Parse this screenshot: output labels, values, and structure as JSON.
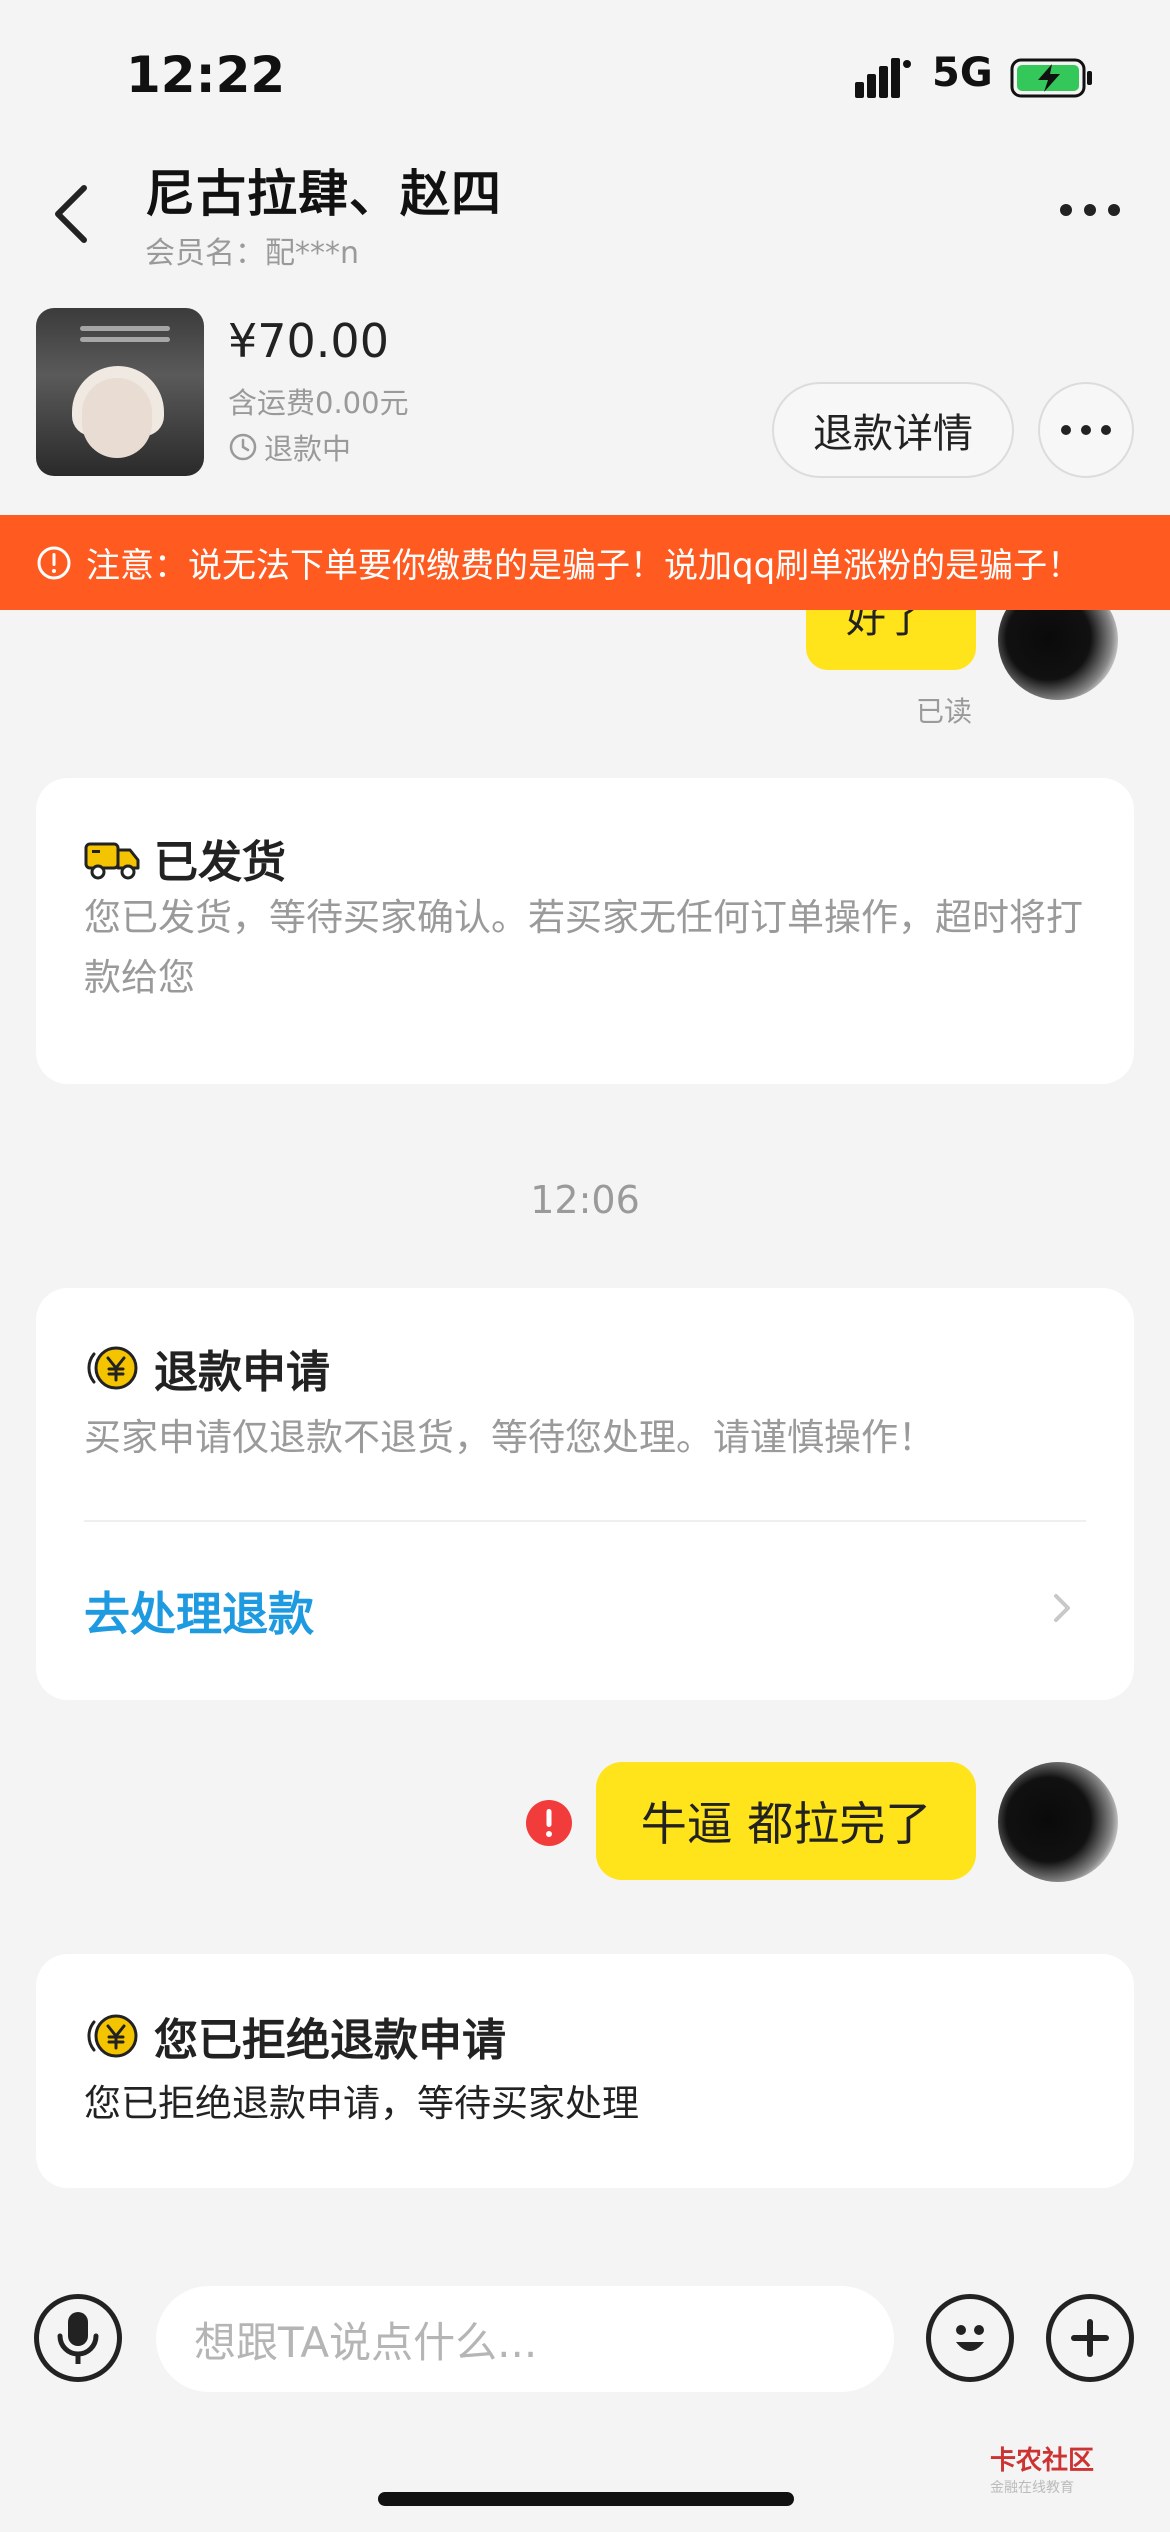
{
  "status_bar": {
    "time": "12:22",
    "network": "5G"
  },
  "header": {
    "title": "尼古拉肆、赵四",
    "member_label": "会员名：配***n"
  },
  "order": {
    "price": "¥70.00",
    "shipping": "含运费0.00元",
    "status": "退款中",
    "refund_detail_label": "退款详情"
  },
  "warning": {
    "text": "注意：说无法下单要你缴费的是骗子！说加qq刷单涨粉的是骗子！"
  },
  "chat": {
    "top_bubble": "好了",
    "read_label": "已读",
    "shipped_card": {
      "title": "已发货",
      "text": "您已发货，等待买家确认。若买家无任何订单操作，超时将打款给您"
    },
    "timestamp": "12:06",
    "refund_card": {
      "title": "退款申请",
      "text": "买家申请仅退款不退货，等待您处理。请谨慎操作！",
      "link": "去处理退款"
    },
    "message": "牛逼 都拉完了",
    "rejected_card": {
      "title": "您已拒绝退款申请",
      "text": "您已拒绝退款申请，等待买家处理"
    }
  },
  "input": {
    "placeholder": "想跟TA说点什么..."
  },
  "watermark": {
    "title": "卡农社区",
    "subtitle": "金融在线教育"
  },
  "colors": {
    "accent_yellow": "#ffe31b",
    "warning_orange": "#ff5a1f",
    "link_blue": "#1e9ae0"
  }
}
